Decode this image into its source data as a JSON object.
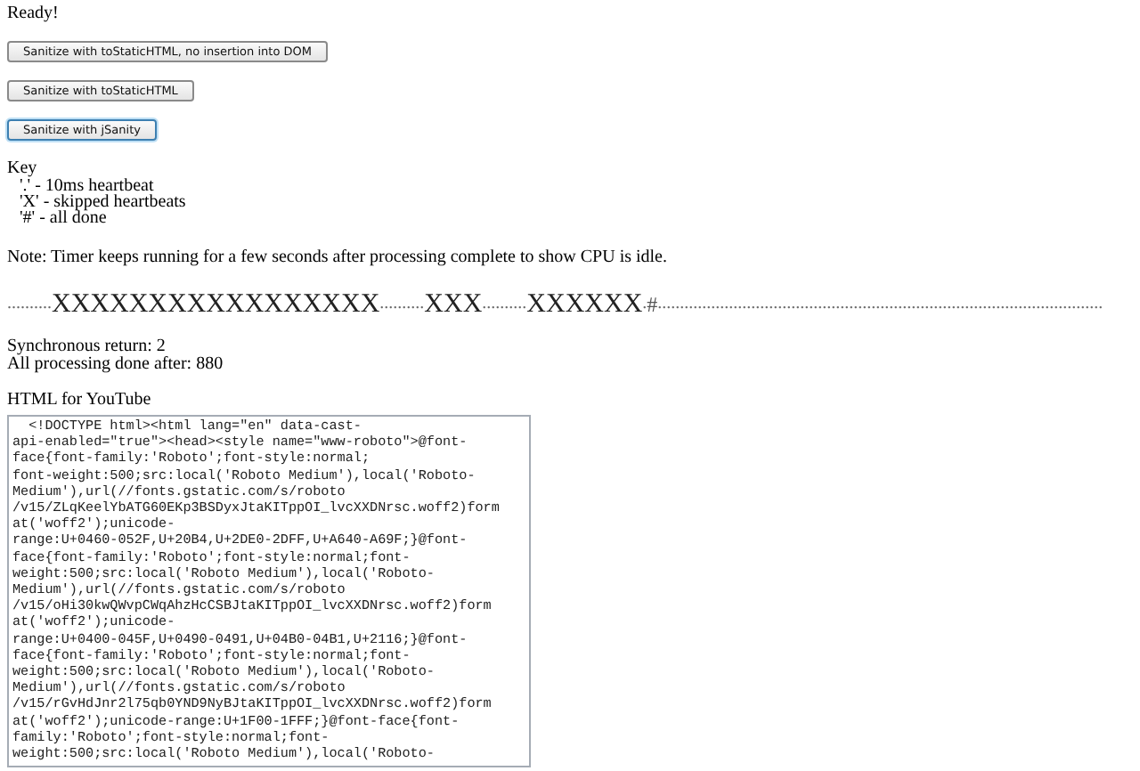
{
  "status": "Ready!",
  "buttons": [
    {
      "label": "Sanitize with toStaticHTML, no insertion into DOM",
      "focused": false
    },
    {
      "label": "Sanitize with toStaticHTML",
      "focused": false
    },
    {
      "label": "Sanitize with jSanity",
      "focused": true
    }
  ],
  "key": {
    "title": "Key",
    "items": [
      "'.' - 10ms heartbeat",
      "'X' - skipped heartbeats",
      "'#' - all done"
    ]
  },
  "note": "Note: Timer keeps running for a few seconds after processing complete to show CPU is idle.",
  "heartbeat": [
    {
      "kind": "beat",
      "text": ".........."
    },
    {
      "kind": "skipped",
      "text": "XXXXXXXXXXXXXXXXX"
    },
    {
      "kind": "beat",
      "text": ".........."
    },
    {
      "kind": "skipped",
      "text": "XXX"
    },
    {
      "kind": "beat",
      "text": ".........."
    },
    {
      "kind": "skipped",
      "text": "XXXXXX"
    },
    {
      "kind": "beat",
      "text": "."
    },
    {
      "kind": "done",
      "text": "#"
    },
    {
      "kind": "beat",
      "text": "...................................................................................................."
    }
  ],
  "results": [
    "Synchronous return: 2",
    "All processing done after: 880"
  ],
  "output": {
    "label": "HTML for YouTube",
    "lines": [
      "  <!DOCTYPE html><html lang=\"en\" data-cast-",
      "api-enabled=\"true\"><head><style name=\"www-roboto\">@font-",
      "face{font-family:'Roboto';font-style:normal;",
      "font-weight:500;src:local('Roboto Medium'),local('Roboto-",
      "Medium'),url(//fonts.gstatic.com/s/roboto",
      "/v15/ZLqKeelYbATG60EKp3BSDyxJtaKITppOI_lvcXXDNrsc.woff2)form",
      "at('woff2');unicode-",
      "range:U+0460-052F,U+20B4,U+2DE0-2DFF,U+A640-A69F;}@font-",
      "face{font-family:'Roboto';font-style:normal;font-",
      "weight:500;src:local('Roboto Medium'),local('Roboto-",
      "Medium'),url(//fonts.gstatic.com/s/roboto",
      "/v15/oHi30kwQWvpCWqAhzHcCSBJtaKITppOI_lvcXXDNrsc.woff2)form",
      "at('woff2');unicode-",
      "range:U+0400-045F,U+0490-0491,U+04B0-04B1,U+2116;}@font-",
      "face{font-family:'Roboto';font-style:normal;font-",
      "weight:500;src:local('Roboto Medium'),local('Roboto-",
      "Medium'),url(//fonts.gstatic.com/s/roboto",
      "/v15/rGvHdJnr2l75qb0YND9NyBJtaKITppOI_lvcXXDNrsc.woff2)form",
      "at('woff2');unicode-range:U+1F00-1FFF;}@font-face{font-",
      "family:'Roboto';font-style:normal;font-",
      "weight:500;src:local('Roboto Medium'),local('Roboto-"
    ]
  }
}
